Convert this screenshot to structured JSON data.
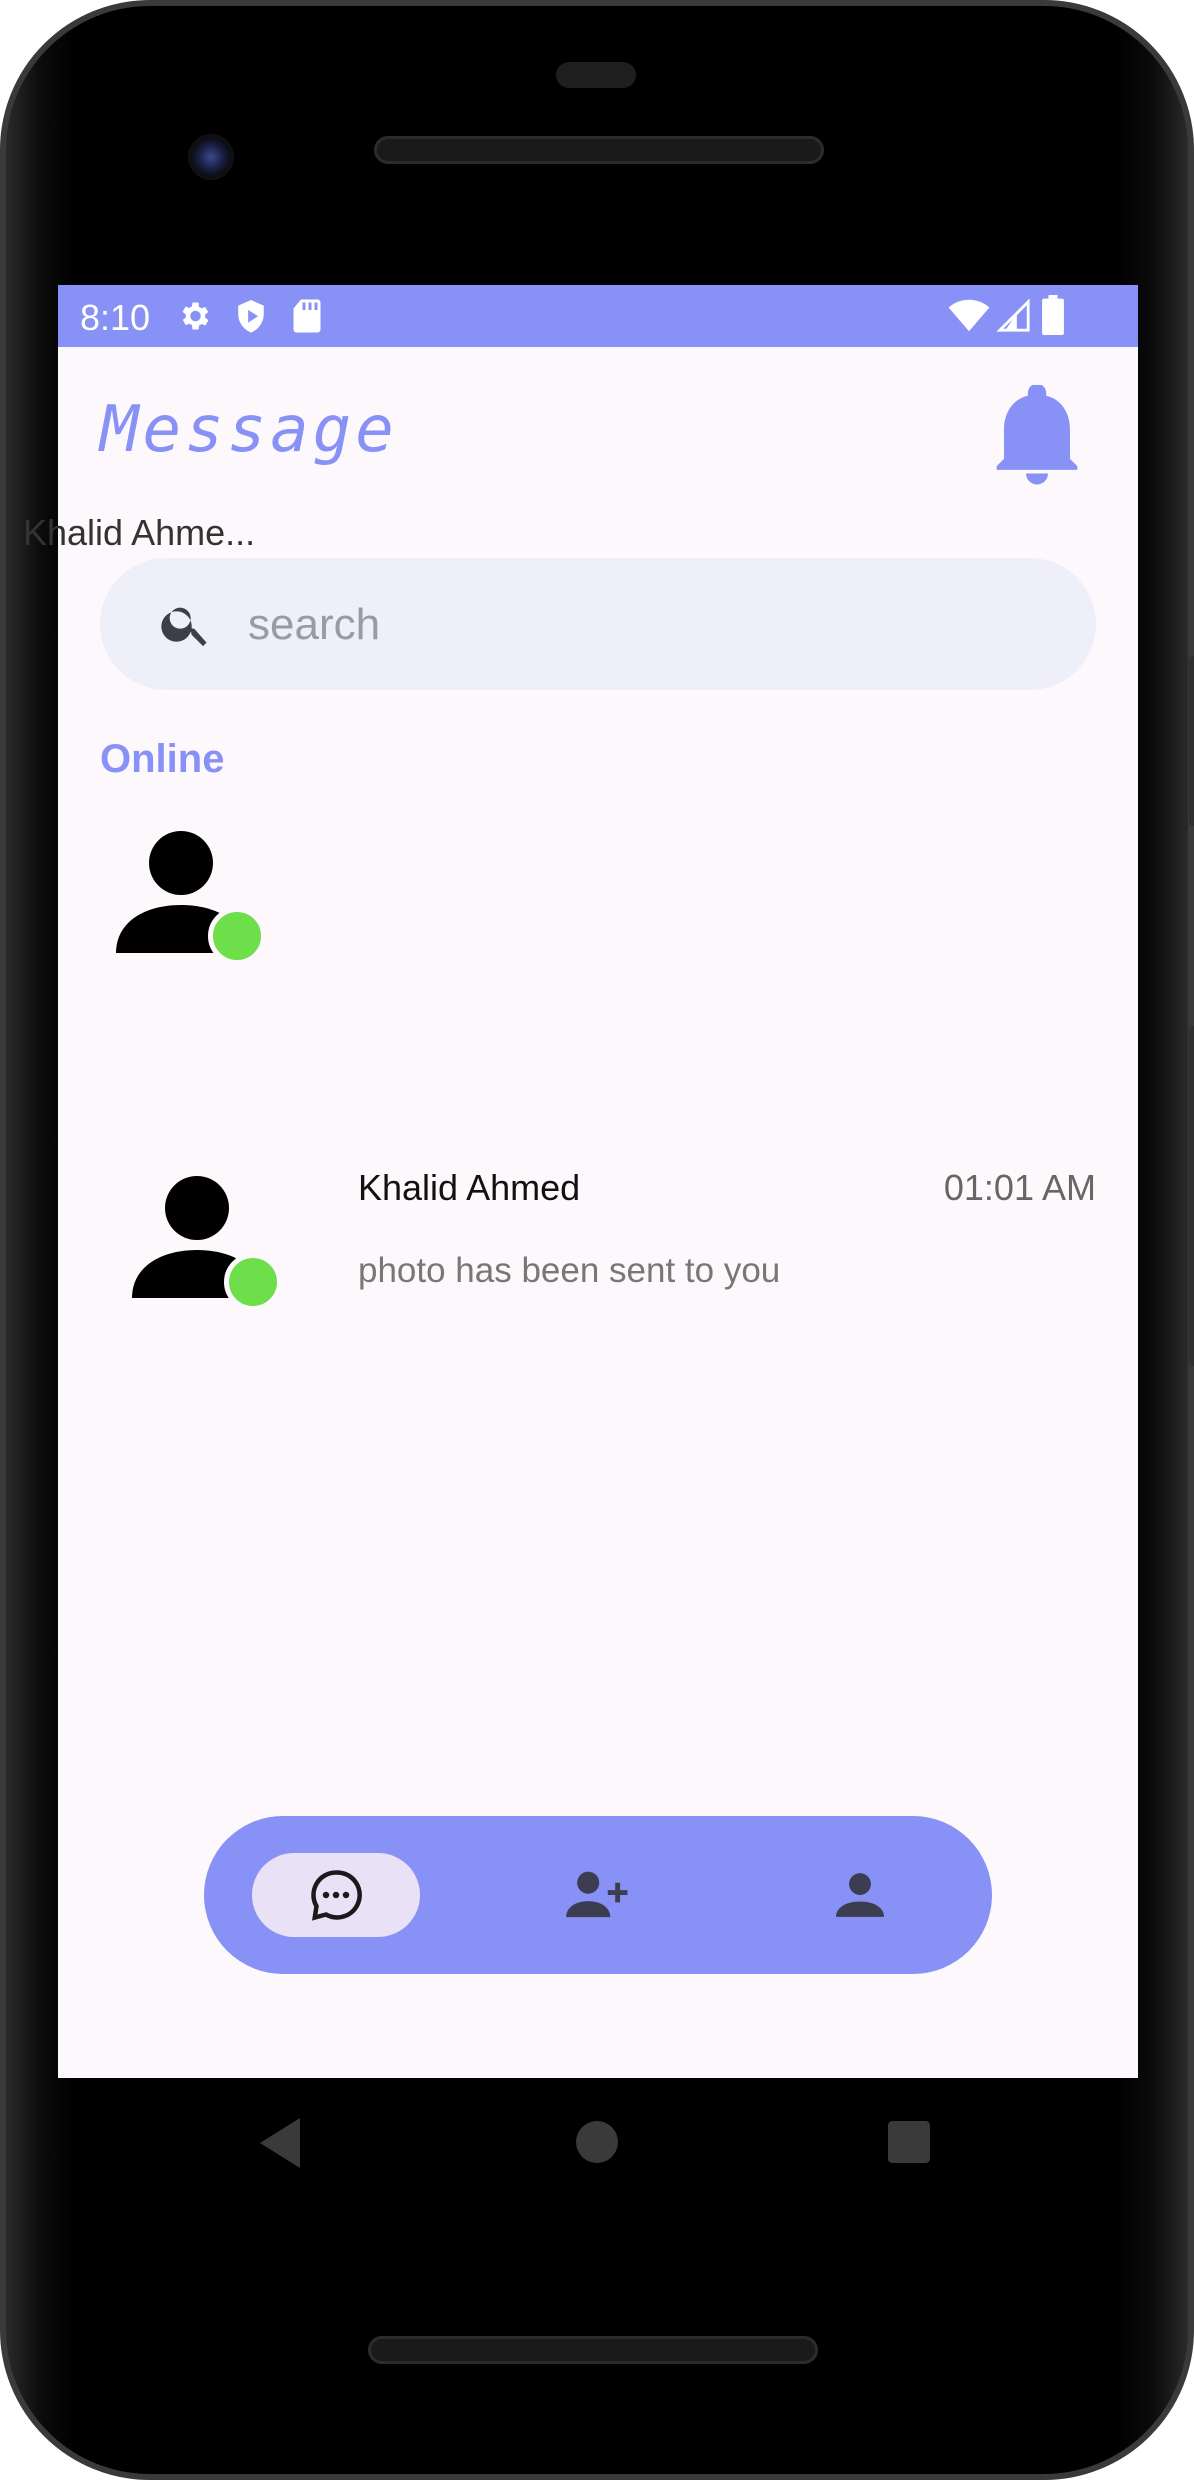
{
  "status_bar": {
    "time": "8:10",
    "icons": [
      "settings-icon",
      "shield-icon",
      "sd-card-icon",
      "wifi-icon",
      "signal-icon",
      "battery-icon"
    ],
    "background": "#8891f5"
  },
  "header": {
    "title": "Message",
    "bell_icon": "notification-bell-icon"
  },
  "search": {
    "placeholder": "search",
    "value": ""
  },
  "online_section": {
    "label": "Online",
    "users": [
      {
        "name": "Khalid Ahme...",
        "status": "online"
      }
    ]
  },
  "chats": [
    {
      "name": "Khalid Ahmed",
      "time": "01:01 AM",
      "preview": "photo has been sent to you",
      "status": "online"
    }
  ],
  "bottom_nav": {
    "items": [
      {
        "icon": "chat-bubble-icon",
        "active": true
      },
      {
        "icon": "add-friend-icon",
        "active": false
      },
      {
        "icon": "profile-icon",
        "active": false
      }
    ]
  },
  "system_nav": [
    "back-icon",
    "home-icon",
    "recents-icon"
  ],
  "colors": {
    "accent": "#8891f5",
    "online_dot": "#6fde4b",
    "screen_bg": "#fdf8fc",
    "search_bg": "#eeeff9",
    "nav_active": "#e9e2f6"
  }
}
